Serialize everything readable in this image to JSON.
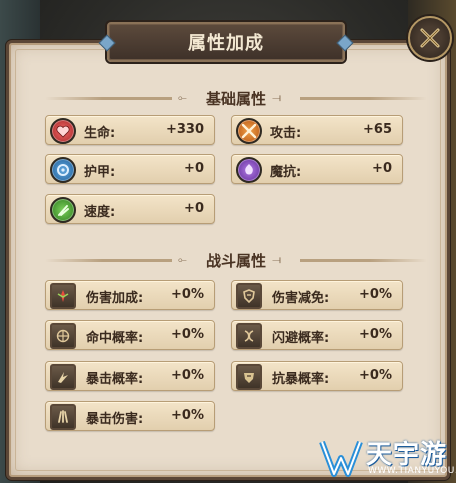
{
  "dialog": {
    "title": "属性加成"
  },
  "basic": {
    "section_title": "基础属性",
    "stats": [
      {
        "label": "生命:",
        "value": "+330",
        "icon": "heart-icon",
        "color": "#c23a3a"
      },
      {
        "label": "攻击:",
        "value": "+65",
        "icon": "crossed-swords-icon",
        "color": "#c8661c"
      },
      {
        "label": "护甲:",
        "value": "+0",
        "icon": "shield-icon",
        "color": "#2f77b5"
      },
      {
        "label": "魔抗:",
        "value": "+0",
        "icon": "magic-resist-icon",
        "color": "#7c3fb1"
      },
      {
        "label": "速度:",
        "value": "+0",
        "icon": "speed-boot-icon",
        "color": "#3e9a2c"
      }
    ]
  },
  "combat": {
    "section_title": "战斗属性",
    "stats": [
      {
        "label": "伤害加成:",
        "value": "+0%",
        "icon": "damage-bonus-icon"
      },
      {
        "label": "伤害减免:",
        "value": "+0%",
        "icon": "damage-reduction-icon"
      },
      {
        "label": "命中概率:",
        "value": "+0%",
        "icon": "hit-rate-icon"
      },
      {
        "label": "闪避概率:",
        "value": "+0%",
        "icon": "dodge-rate-icon"
      },
      {
        "label": "暴击概率:",
        "value": "+0%",
        "icon": "crit-rate-icon"
      },
      {
        "label": "抗暴概率:",
        "value": "+0%",
        "icon": "crit-resist-icon"
      },
      {
        "label": "暴击伤害:",
        "value": "+0%",
        "icon": "crit-damage-icon"
      }
    ]
  },
  "watermark": {
    "name": "天宇游",
    "url": "WWW.TIANYUYOU.CN"
  }
}
